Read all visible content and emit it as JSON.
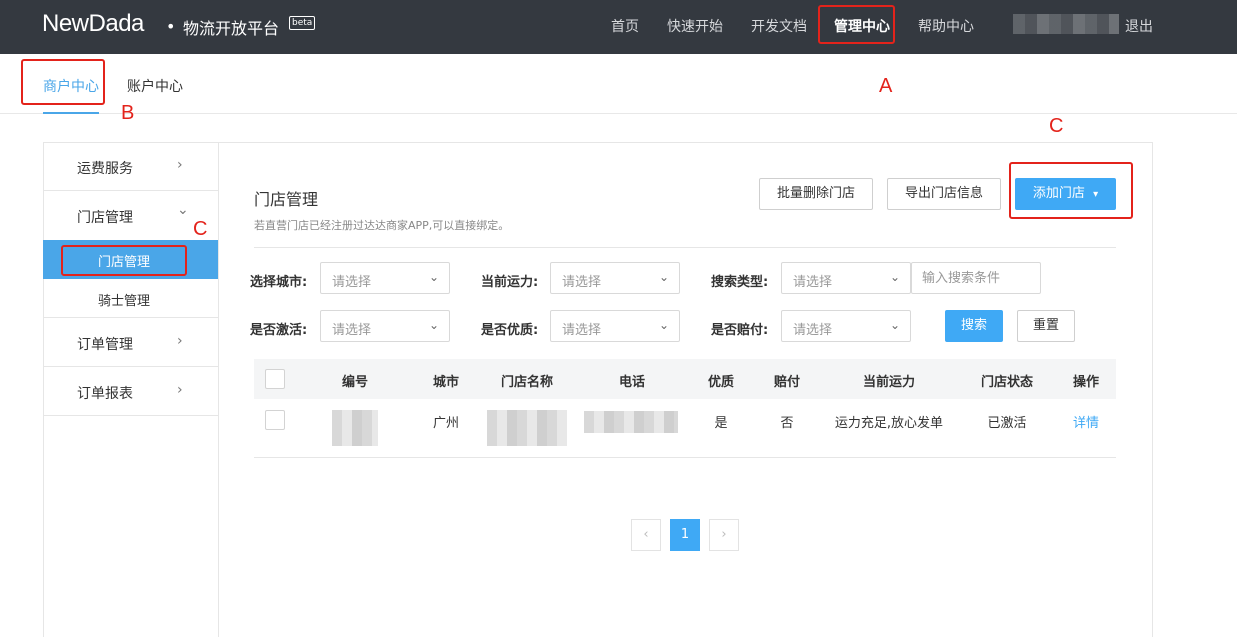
{
  "header": {
    "logo": "NewDada",
    "dot": "•",
    "platform": "物流开放平台",
    "beta": "beta",
    "nav": [
      {
        "label": "首页"
      },
      {
        "label": "快速开始"
      },
      {
        "label": "开发文档"
      },
      {
        "label": "管理中心",
        "active": true
      },
      {
        "label": "帮助中心"
      }
    ],
    "logout": "退出"
  },
  "subnav": {
    "tabs": [
      {
        "label": "商户中心",
        "active": true
      },
      {
        "label": "账户中心"
      }
    ]
  },
  "annotations": {
    "a": "A",
    "b": "B",
    "c1": "C",
    "c2": "C",
    "color": "#e3231b"
  },
  "sidebar": {
    "items": [
      {
        "label": "运费服务",
        "icon": "chevron-right-icon",
        "glyph": "›"
      },
      {
        "label": "门店管理",
        "icon": "chevron-down-icon",
        "glyph": "⌄"
      },
      {
        "label": "订单管理",
        "icon": "chevron-right-icon",
        "glyph": "›"
      },
      {
        "label": "订单报表",
        "icon": "chevron-right-icon",
        "glyph": "›"
      }
    ],
    "subitems": [
      {
        "label": "门店管理",
        "active": true
      },
      {
        "label": "骑士管理"
      }
    ]
  },
  "content": {
    "title": "门店管理",
    "hint": "若直营门店已经注册过达达商家APP,可以直接绑定。",
    "buttons": {
      "batch_delete": "批量删除门店",
      "export": "导出门店信息",
      "add_store": "添加门店",
      "add_caret": "▾"
    },
    "filters": {
      "city_label": "选择城市:",
      "capacity_label": "当前运力:",
      "search_type_label": "搜索类型:",
      "activated_label": "是否激活:",
      "quality_label": "是否优质:",
      "compensate_label": "是否赔付:",
      "select_placeholder": "请选择",
      "caret": "⌄",
      "search_placeholder": "输入搜索条件",
      "search_button": "搜索",
      "reset_button": "重置"
    },
    "table": {
      "headers": [
        "编号",
        "城市",
        "门店名称",
        "电话",
        "优质",
        "赔付",
        "当前运力",
        "门店状态",
        "操作"
      ],
      "rows": [
        {
          "city": "广州",
          "quality": "是",
          "compensate": "否",
          "capacity": "运力充足,放心发单",
          "status": "已激活",
          "action": "详情"
        }
      ]
    },
    "pagination": {
      "prev": "‹",
      "current": "1",
      "next": "›"
    }
  },
  "colors": {
    "topbar": "#343940",
    "accent": "#3fa9f5"
  }
}
